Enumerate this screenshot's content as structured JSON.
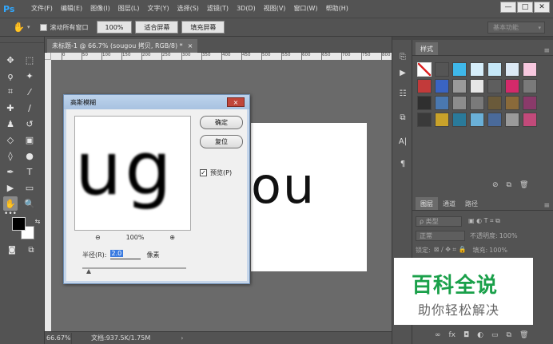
{
  "app": {
    "logo": "Ps",
    "menu": [
      "文件(F)",
      "编辑(E)",
      "图像(I)",
      "图层(L)",
      "文字(Y)",
      "选择(S)",
      "滤镜(T)",
      "3D(D)",
      "视图(V)",
      "窗口(W)",
      "帮助(H)"
    ],
    "window_controls": [
      "minimize-icon",
      "restore-icon",
      "close-icon"
    ]
  },
  "options_bar": {
    "tool_icon": "hand-icon",
    "scroll_all_label": "滚动所有窗口",
    "zoom_btn": "100%",
    "fit_btn": "适合屏幕",
    "fill_btn": "填充屏幕",
    "workspace": "基本功能"
  },
  "document": {
    "tab_title": "未标题-1 @ 66.7% (sougou  拷贝, RGB/8) *",
    "tab_close": "×",
    "ruler_ticks": [
      "0",
      "50",
      "100",
      "150",
      "200",
      "250",
      "300",
      "350",
      "400",
      "450",
      "500",
      "550",
      "600",
      "650",
      "700",
      "750",
      "800"
    ],
    "canvas_text": "ou",
    "status_zoom": "66.67%",
    "status_doc": "文档:937.5K/1.75M",
    "status_arrow": "›"
  },
  "dialog": {
    "title": "高斯模糊",
    "close": "×",
    "preview_text": "ug",
    "zoom_out": "⊖",
    "zoom_level": "100%",
    "zoom_in": "⊕",
    "ok": "确定",
    "reset": "复位",
    "preview_label": "预览(P)",
    "preview_checked": "✓",
    "radius_label": "半径(R):",
    "radius_value": "2.0",
    "radius_unit": "像素"
  },
  "right_panels": {
    "styles_tab": "样式",
    "layers_tabs": [
      "图层",
      "通道",
      "路径"
    ],
    "kind_filter": "ρ 类型",
    "blend_mode": "正常",
    "opacity_label": "不透明度:",
    "opacity_value": "100%",
    "lock_label": "锁定:",
    "fill_label": "填充:",
    "fill_value": "100%",
    "styles_colors": [
      "#ffffff",
      "#555555",
      "#3fb8ea",
      "#d6eefa",
      "#c5e7f7",
      "#dce9f5",
      "#f7c8df",
      "#c23a3a",
      "#3a64c2",
      "#9a9a9a",
      "#e6e6e6",
      "#5e5e5e",
      "#d42a6a",
      "#7a7a7a",
      "#2f2f2f",
      "#4a78b0",
      "#8c8c8c",
      "#7a7a7a",
      "#6a5a3a",
      "#8a6a3a",
      "#8a3a6a",
      "#3a3a3a",
      "#c9a22a",
      "#2a7a9a",
      "#6ab0d8",
      "#4a6a9a",
      "#9a9a9a",
      "#c24a7a"
    ]
  },
  "watermark": {
    "title": "百科全说",
    "subtitle": "助你轻松解决",
    "title_color": "#1aa04a"
  }
}
